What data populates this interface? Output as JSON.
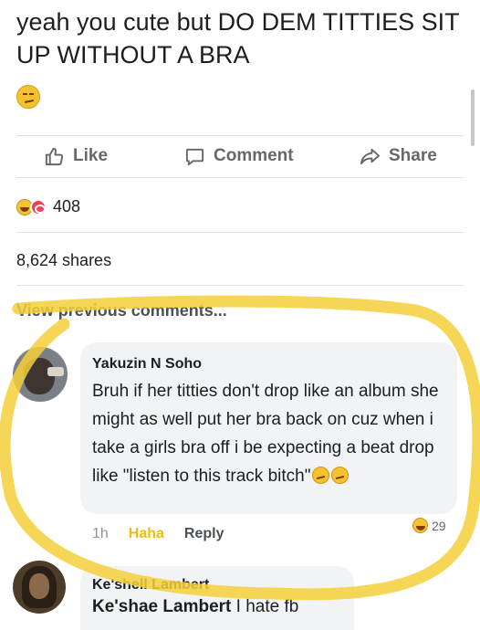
{
  "post": {
    "text": "yeah you cute but DO DEM TITTIES SIT UP WITHOUT A BRA",
    "emoji": "smirk-emoji"
  },
  "actions": {
    "like": "Like",
    "comment": "Comment",
    "share": "Share"
  },
  "reactions": {
    "count": "408",
    "types": [
      "haha-icon",
      "love-icon"
    ]
  },
  "shares": "8,624 shares",
  "view_previous": "View previous comments...",
  "comments": [
    {
      "author": "Yakuzin N Soho",
      "text": "Bruh if her titties don't drop like an album she might as well put her bra back on cuz when i take a girls bra off i be expecting a beat drop like \"listen to this track bitch\"",
      "time": "1h",
      "reaction_action": "Haha",
      "reply": "Reply",
      "reaction_count": "29"
    },
    {
      "author": "Ke'shell Lambert",
      "mention": "Ke'shae Lambert",
      "text": " I hate fb"
    }
  ],
  "colors": {
    "highlight": "#f4cf3a",
    "action_gray": "#65676b",
    "haha_yellow": "#f0ba15",
    "bubble_bg": "#f2f3f5"
  }
}
